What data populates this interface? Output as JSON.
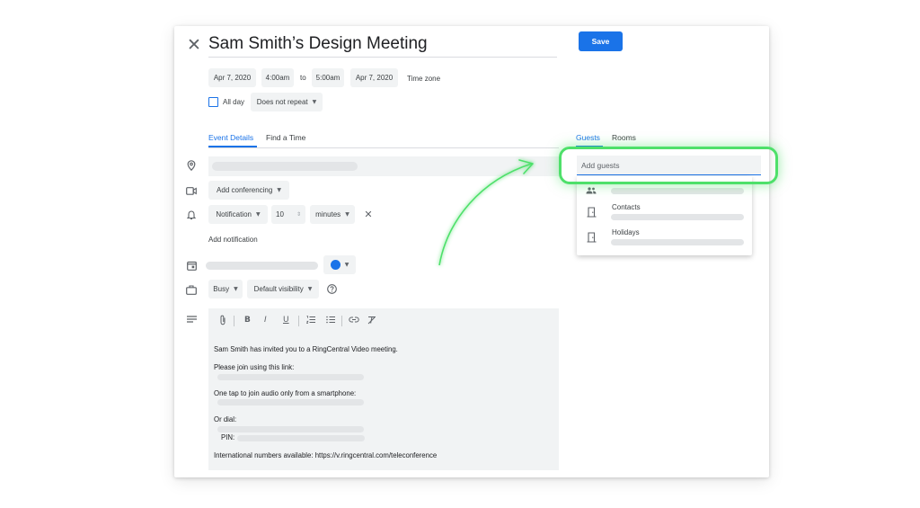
{
  "event": {
    "title": "Sam Smith’s Design Meeting",
    "save_label": "Save",
    "start_date": "Apr 7, 2020",
    "start_time": "4:00am",
    "to_label": "to",
    "end_time": "5:00am",
    "end_date": "Apr 7, 2020",
    "timezone_label": "Time zone",
    "all_day_label": "All day",
    "repeat_value": "Does not repeat"
  },
  "tabs": {
    "event_details": "Event Details",
    "find_a_time": "Find a Time"
  },
  "details": {
    "conferencing": "Add conferencing",
    "notification_type": "Notification",
    "notification_value": "10",
    "notification_unit": "minutes",
    "add_notification": "Add notification",
    "busy": "Busy",
    "visibility": "Default visibility"
  },
  "description": {
    "line1": "Sam Smith has invited you to a RingCentral Video meeting.",
    "line2": "Please join using this link:",
    "line3": "One tap to join audio only from a smartphone:",
    "line4": "Or dial:",
    "pin_label": "PIN:",
    "line5": "International numbers available: https://v.ringcentral.com/teleconference"
  },
  "guests": {
    "tab_guests": "Guests",
    "tab_rooms": "Rooms",
    "input_placeholder": "Add guests",
    "suggestions": [
      {
        "label": "",
        "icon": "people-icon"
      },
      {
        "label": "Contacts",
        "icon": "door-icon"
      },
      {
        "label": "Holidays",
        "icon": "door-icon"
      }
    ]
  },
  "colors": {
    "accent": "#1a73e8",
    "highlight": "#4ee06a"
  }
}
